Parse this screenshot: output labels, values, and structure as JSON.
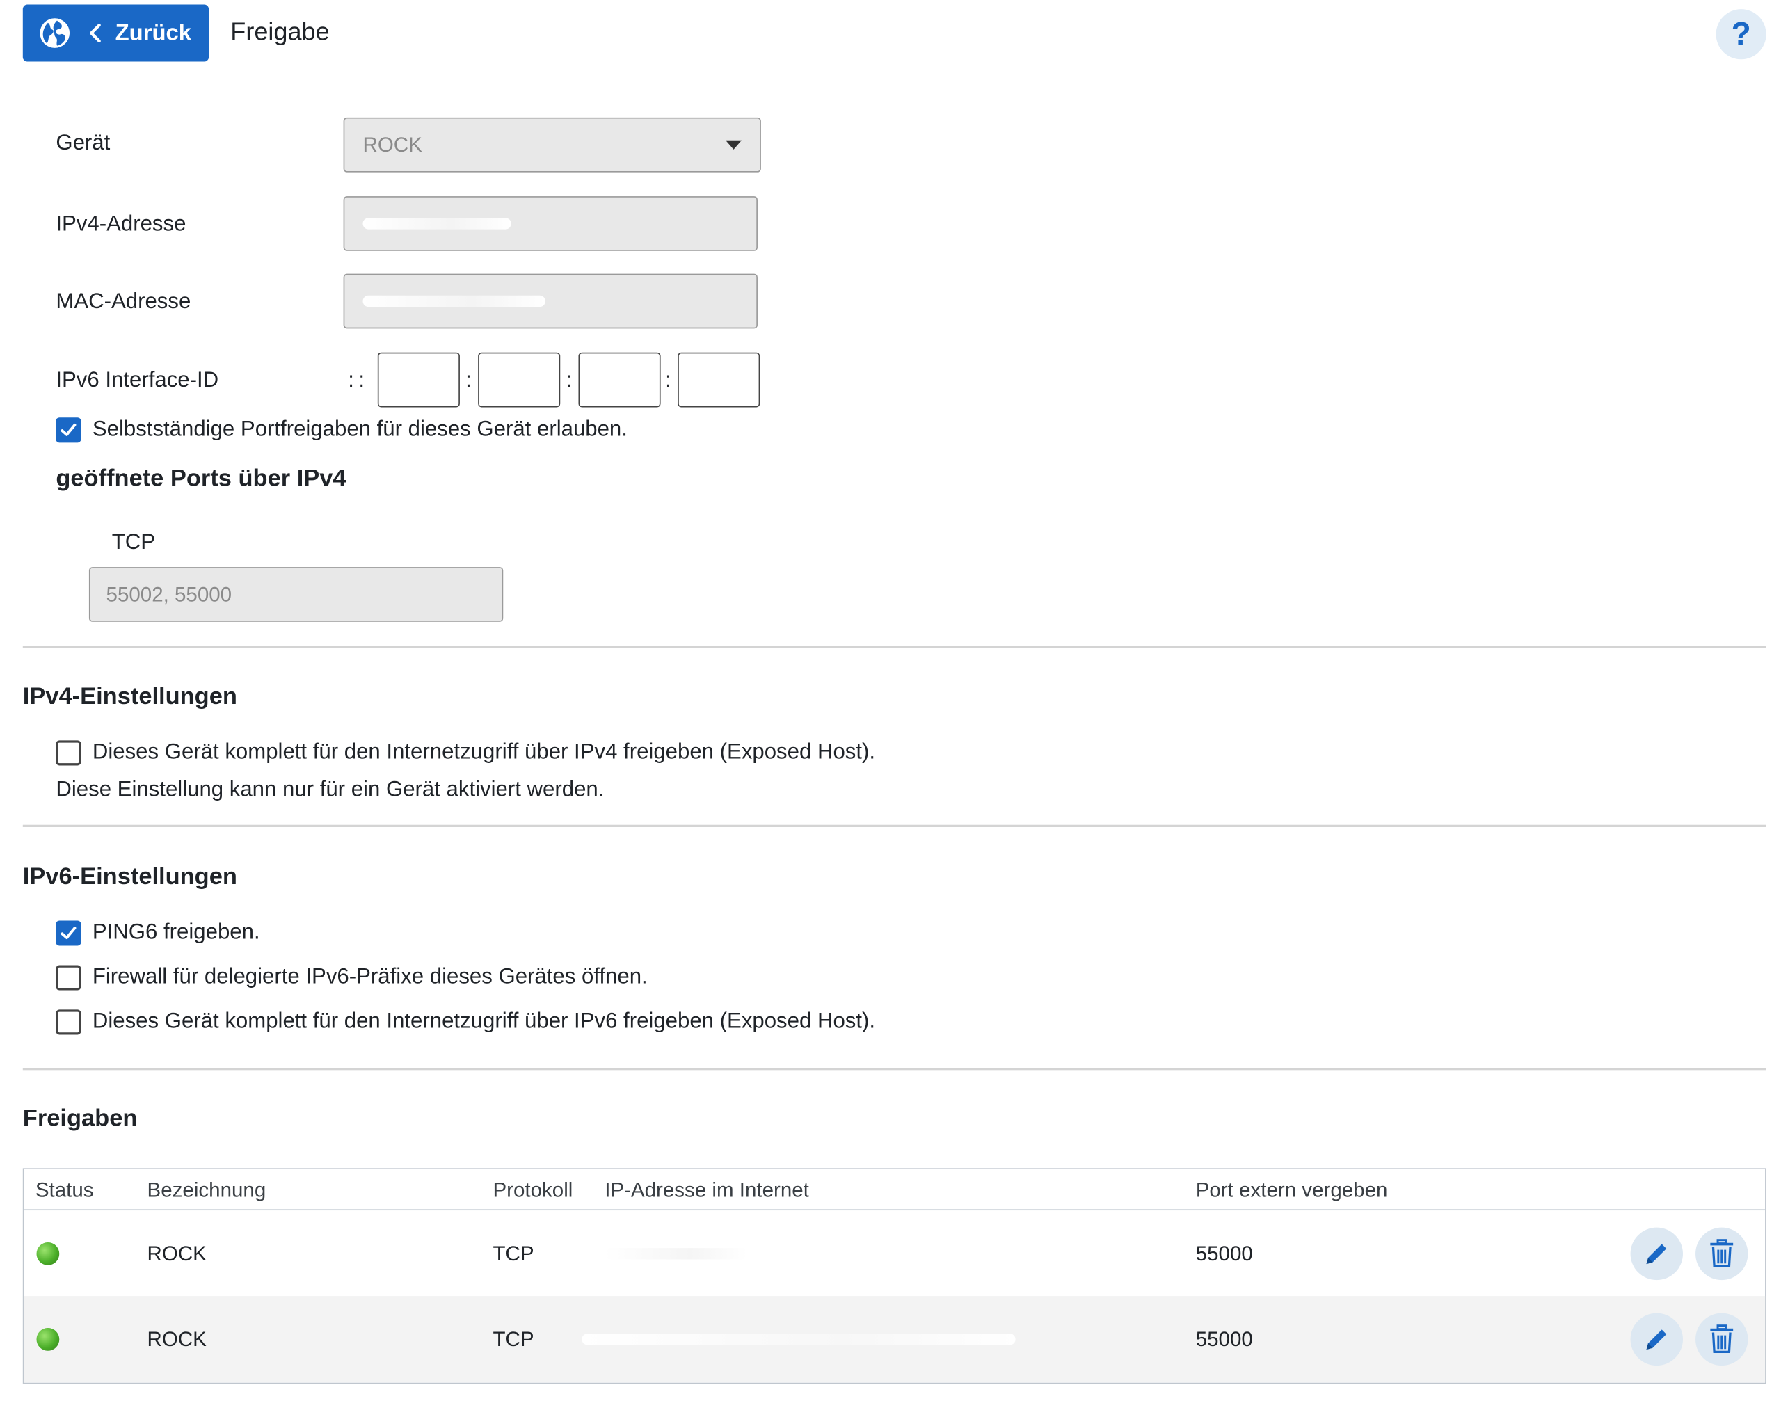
{
  "header": {
    "back_label": "Zurück",
    "title": "Freigabe",
    "help_label": "?"
  },
  "form": {
    "device_label": "Gerät",
    "device_value": "ROCK",
    "ipv4_label": "IPv4-Adresse",
    "mac_label": "MAC-Adresse",
    "ipv6_label": "IPv6 Interface-ID",
    "ipv6_prefix": "::",
    "ipv6_sep": ":",
    "allow_self_ports": "Selbstständige Portfreigaben für dieses Gerät erlauben."
  },
  "open_ports": {
    "title": "geöffnete Ports über IPv4",
    "tcp_label": "TCP",
    "tcp_value": "55002, 55000"
  },
  "ipv4_settings": {
    "title": "IPv4-Einstellungen",
    "exposed_host": "Dieses Gerät komplett für den Internetzugriff über IPv4 freigeben (Exposed Host).",
    "note": "Diese Einstellung kann nur für ein Gerät aktiviert werden."
  },
  "ipv6_settings": {
    "title": "IPv6-Einstellungen",
    "ping6": "PING6 freigeben.",
    "firewall": "Firewall für delegierte IPv6-Präfixe dieses Gerätes öffnen.",
    "exposed_host": "Dieses Gerät komplett für den Internetzugriff über IPv6 freigeben (Exposed Host)."
  },
  "freigaben": {
    "title": "Freigaben",
    "columns": {
      "status": "Status",
      "name": "Bezeichnung",
      "protocol": "Protokoll",
      "ip": "IP-Adresse im Internet",
      "port": "Port extern vergeben"
    },
    "rows": [
      {
        "name": "ROCK",
        "protocol": "TCP",
        "port": "55000"
      },
      {
        "name": "ROCK",
        "protocol": "TCP",
        "port": "55000"
      }
    ]
  },
  "colors": {
    "accent": "#1a68c6",
    "status_active": "#4caf2a"
  },
  "icons": [
    "globe-icon",
    "chevron-left-icon",
    "help-icon",
    "checkmark-icon",
    "caret-down-icon",
    "pencil-icon",
    "trash-icon"
  ]
}
